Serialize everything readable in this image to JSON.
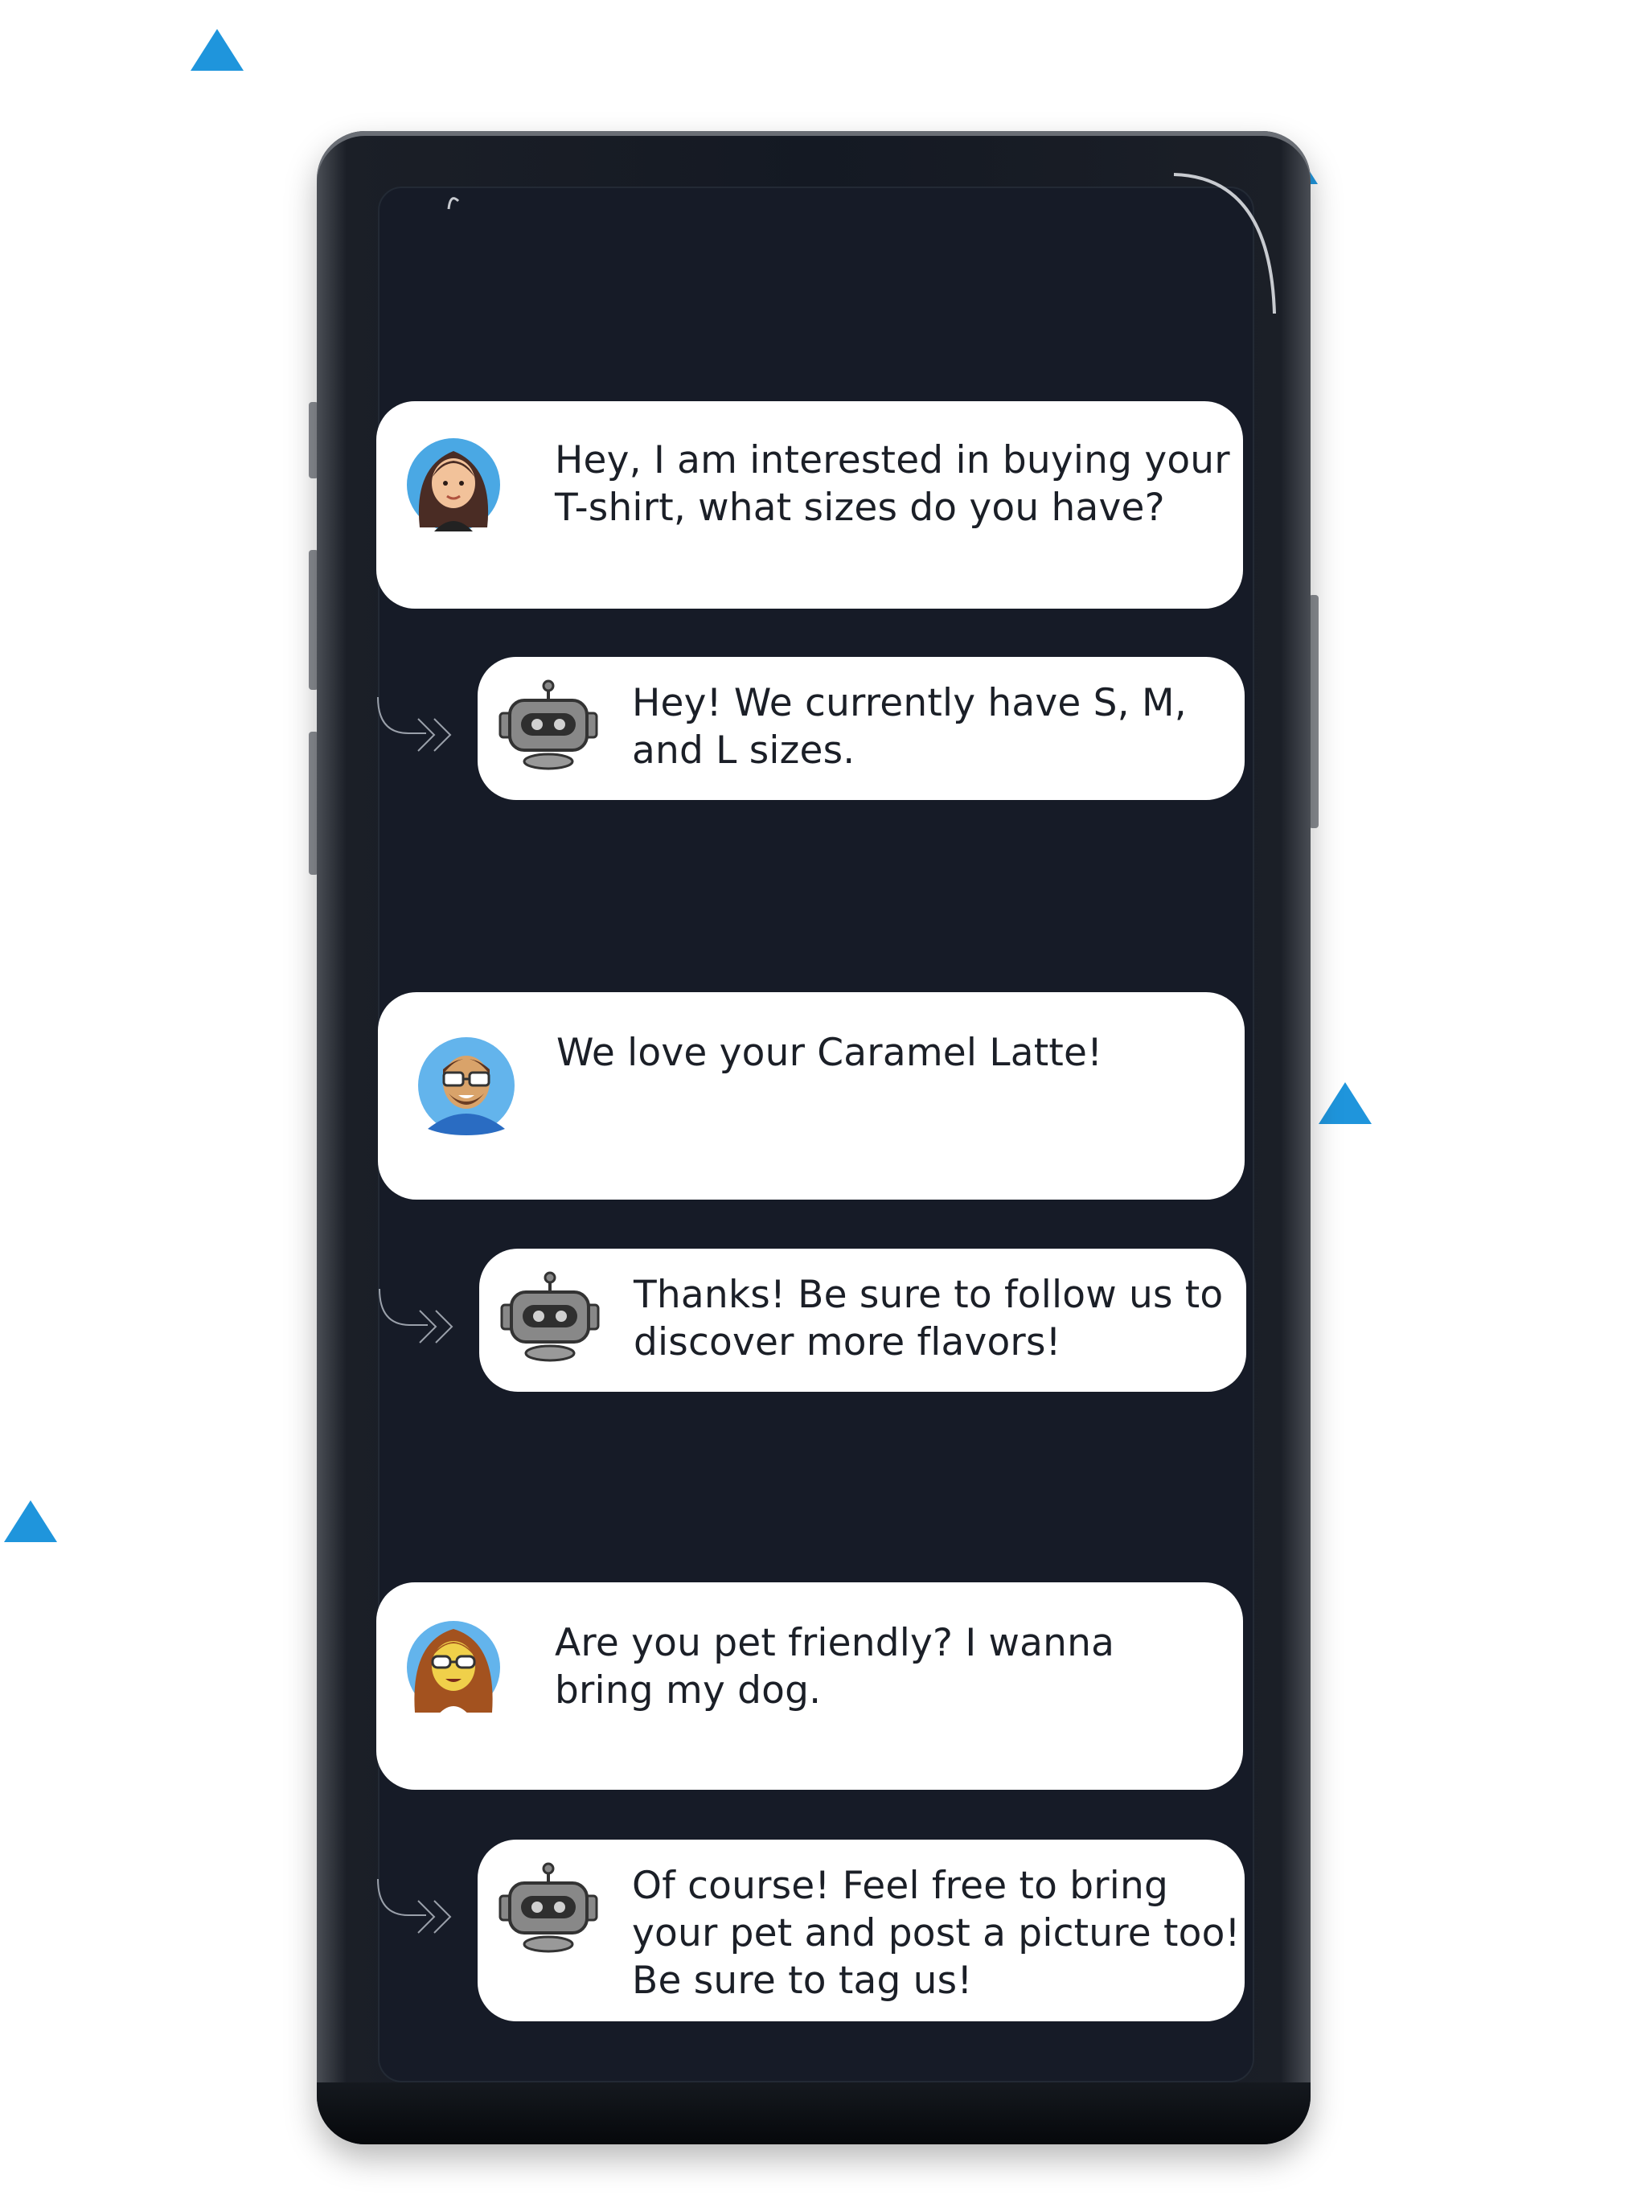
{
  "colors": {
    "accent": "#1f95dc",
    "screen_bg": "#161b27",
    "bubble_bg": "#ffffff",
    "text": "#1b1f27"
  },
  "conversation": [
    {
      "user": {
        "avatar_icon": "woman-avatar-icon",
        "text": "Hey, I am interested in buying your\nT-shirt, what sizes do you have?"
      },
      "bot": {
        "avatar_icon": "robot-icon",
        "text": "Hey! We currently have S, M,\nand L sizes."
      }
    },
    {
      "user": {
        "avatar_icon": "man-with-glasses-avatar-icon",
        "text": "We love your Caramel Latte!"
      },
      "bot": {
        "avatar_icon": "robot-icon",
        "text": "Thanks! Be sure to follow us to\ndiscover more flavors!"
      }
    },
    {
      "user": {
        "avatar_icon": "woman-with-sunglasses-avatar-icon",
        "text": "Are you pet friendly? I wanna\nbring my dog."
      },
      "bot": {
        "avatar_icon": "robot-icon",
        "text": "Of course! Feel free to bring\nyour pet and post a picture too!\nBe sure to tag us!"
      }
    }
  ]
}
